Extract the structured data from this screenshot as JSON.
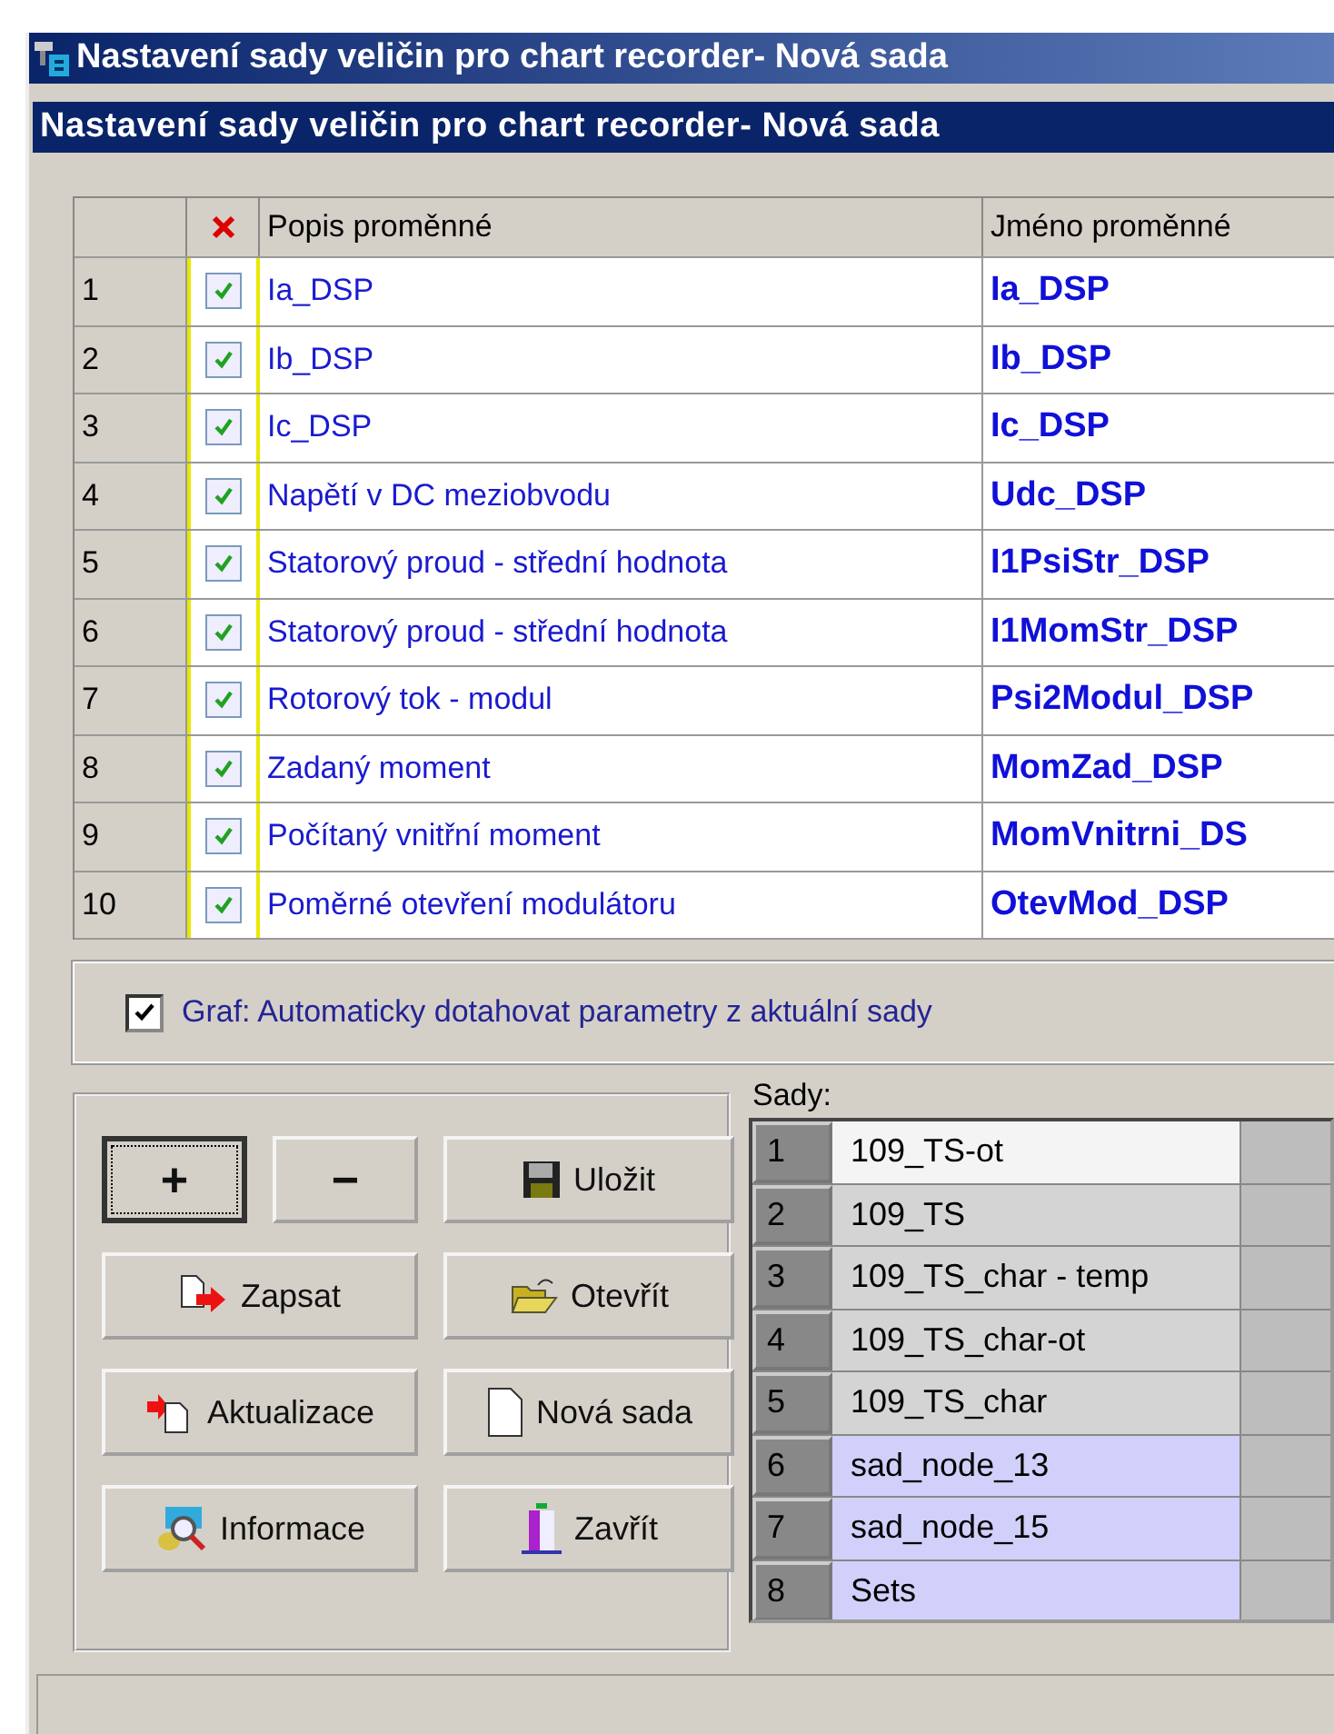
{
  "outer_window": {
    "title": "Nastavení sady veličin pro chart recorder- Nová sada"
  },
  "dialog": {
    "title": "Nastavení sady veličin pro chart recorder- Nová sada"
  },
  "table": {
    "columns": [
      "Popis proměnné",
      "Jméno proměnné"
    ],
    "rows": [
      {
        "number": "1",
        "checked": true,
        "description": "Ia_DSP",
        "name": "Ia_DSP"
      },
      {
        "number": "2",
        "checked": true,
        "description": "Ib_DSP",
        "name": "Ib_DSP"
      },
      {
        "number": "3",
        "checked": true,
        "description": "Ic_DSP",
        "name": "Ic_DSP"
      },
      {
        "number": "4",
        "checked": true,
        "description": "Napětí v DC meziobvodu",
        "name": "Udc_DSP"
      },
      {
        "number": "5",
        "checked": true,
        "description": "Statorový proud - střední hodnota",
        "name": "I1PsiStr_DSP"
      },
      {
        "number": "6",
        "checked": true,
        "description": "Statorový proud - střední hodnota",
        "name": "I1MomStr_DSP"
      },
      {
        "number": "7",
        "checked": true,
        "description": "Rotorový tok - modul",
        "name": "Psi2Modul_DSP"
      },
      {
        "number": "8",
        "checked": true,
        "description": "Zadaný moment",
        "name": "MomZad_DSP"
      },
      {
        "number": "9",
        "checked": true,
        "description": "Počítaný vnitřní moment",
        "name": "MomVnitrni_DS"
      },
      {
        "number": "10",
        "checked": true,
        "description": "Poměrné otevření modulátoru",
        "name": "OtevMod_DSP"
      }
    ]
  },
  "auto_option": {
    "label": "Graf: Automaticky dotahovat parametry z aktuální sady",
    "checked": true
  },
  "buttons": [
    {
      "kind": "plus",
      "label": "+",
      "focused": true
    },
    {
      "kind": "minus",
      "label": "−",
      "focused": false
    },
    {
      "kind": "save",
      "label": "Uložit",
      "focused": false
    },
    {
      "kind": "write",
      "label": "Zapsat",
      "focused": false
    },
    {
      "kind": "open",
      "label": "Otevřít",
      "focused": false
    },
    {
      "kind": "update",
      "label": "Aktualizace",
      "focused": false
    },
    {
      "kind": "new",
      "label": "Nová sada",
      "focused": false
    },
    {
      "kind": "info",
      "label": "Informace",
      "focused": false
    },
    {
      "kind": "close",
      "label": "Zavřít",
      "focused": false
    }
  ],
  "sets": {
    "label": "Sady:",
    "items": [
      {
        "number": "1",
        "name": "109_TS-ot",
        "color": "#f4f4f4"
      },
      {
        "number": "2",
        "name": "109_TS",
        "color": "#d4d4d4"
      },
      {
        "number": "3",
        "name": "109_TS_char - temp",
        "color": "#d4d4d4"
      },
      {
        "number": "4",
        "name": "109_TS_char-ot",
        "color": "#d4d4d4"
      },
      {
        "number": "5",
        "name": "109_TS_char",
        "color": "#d4d4d4"
      },
      {
        "number": "6",
        "name": "sad_node_13",
        "color": "#d0d0fa"
      },
      {
        "number": "7",
        "name": "sad_node_15",
        "color": "#d0d0fa"
      },
      {
        "number": "8",
        "name": "Sets",
        "color": "#d0d0fa"
      }
    ]
  }
}
